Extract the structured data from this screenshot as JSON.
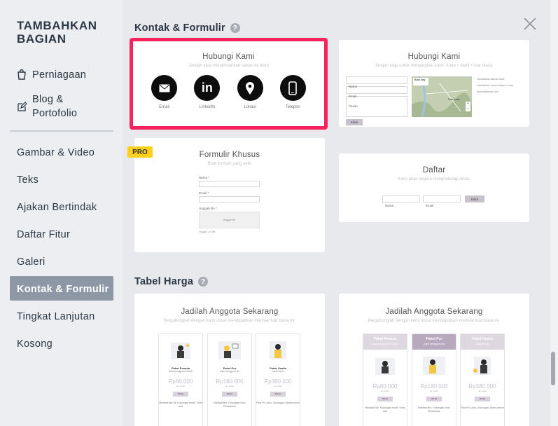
{
  "panel": {
    "title": "TAMBAHKAN BAGIAN"
  },
  "sidebar": {
    "top_items": [
      {
        "label": "Perniagaan",
        "icon": "shopping-bag-icon"
      },
      {
        "label": "Blog & Portofolio",
        "icon": "edit-icon"
      }
    ],
    "items": [
      {
        "label": "Gambar & Video"
      },
      {
        "label": "Teks"
      },
      {
        "label": "Ajakan Bertindak"
      },
      {
        "label": "Daftar Fitur"
      },
      {
        "label": "Galeri"
      },
      {
        "label": "Kontak & Formulir",
        "active": true
      },
      {
        "label": "Tingkat Lanjutan"
      },
      {
        "label": "Kosong"
      }
    ]
  },
  "sections": {
    "contact": {
      "title": "Kontak & Formulir",
      "help": "?"
    },
    "pricing": {
      "title": "Tabel Harga",
      "help": "?"
    }
  },
  "cards": {
    "contact_icons": {
      "title": "Hubungi Kami",
      "subtitle": "Jangan lupa menambahkan tautan ke ikon!",
      "icons": [
        {
          "caption": "Email",
          "icon": "email-icon"
        },
        {
          "caption": "LinkedIn",
          "icon": "linkedin-icon"
        },
        {
          "caption": "Lokasi",
          "icon": "location-pin-icon"
        },
        {
          "caption": "Telepon",
          "icon": "phone-icon"
        }
      ]
    },
    "contact_map": {
      "title": "Hubungi Kami",
      "subtitle": "Jangan ragu untuk menjangkau kami. Anda + kami = luar biasa.",
      "fields": [
        "Nama",
        "Email",
        "Pesan"
      ],
      "button": "Kirim",
      "map_label": "Blast baty",
      "map_city": "San Jose",
      "info": [
        "Tambahkan alamat Anda",
        "Tambahkan nomor telepon Anda",
        "alamat@email.com"
      ]
    },
    "custom_form": {
      "badge": "PRO",
      "title": "Formulir Khusus",
      "subtitle": "Buat formulir yang unik!",
      "fields": [
        "Nama *",
        "Email *",
        "Unggah file *"
      ],
      "upload": "Unggah file",
      "note": "Unggah 10 MB"
    },
    "signup": {
      "title": "Daftar",
      "subtitle": "Kami akan segera menghubungi Anda.",
      "fields": [
        "Nama",
        "Email"
      ],
      "button": "Kirim"
    },
    "pricing_a": {
      "title": "Jadilah Anggota Sekarang",
      "subtitle": "Bergabunglah dengan kami untuk mendapatkan manfaat luar biasa ini.",
      "plans": [
        {
          "name": "Paket Pemula",
          "desc": "untuk pengguna individu",
          "price": "Rp80.000",
          "per": "per bulan",
          "btn": "PILIH",
          "features": "Manfaat fitur ini; Dukungan email; Tidak ada",
          "highlight": false
        },
        {
          "name": "Paket Pro",
          "desc": "untuk pengguna tim",
          "price": "Rp180.000",
          "per": "per bulan",
          "btn": "PILIH",
          "features": "Manfaat fitur; Dukungan chat; Pembaruan",
          "highlight": true
        },
        {
          "name": "Paket Usaha",
          "desc": "untuk bisnis",
          "price": "Rp380.000",
          "per": "per bulan",
          "btn": "PILIH",
          "features": "Fitur Pro, plus; Dukungan; Akses penuh",
          "highlight": false
        }
      ]
    },
    "pricing_b": {
      "title": "Jadilah Anggota Sekarang",
      "subtitle": "Bergabunglah dengan kami untuk mendapatkan manfaat luar biasa ini.",
      "plans": [
        {
          "name": "Paket Pemula",
          "desc": "untuk pengguna individu",
          "price": "Rp80.000",
          "per": "per bulan",
          "btn": "PILIH",
          "features": "Manfaat fitur; Dukungan email; Tidak ada",
          "highlight": false
        },
        {
          "name": "Paket Pro",
          "desc": "untuk pengguna tim",
          "price": "Rp180.000",
          "per": "per bulan",
          "btn": "PILIH",
          "features": "Manfaat fitur; Dukungan chat; Pembaruan",
          "highlight": true
        },
        {
          "name": "Paket Usaha",
          "desc": "untuk bisnis",
          "price": "Rp380.000",
          "per": "per bulan",
          "btn": "PILIH",
          "features": "Fitur Pro, plus; Dukungan; Akses penuh",
          "highlight": false
        }
      ]
    }
  },
  "colors": {
    "selected_border": "#f5245e",
    "active_nav": "#8e97a6",
    "pro_badge": "#ffd11a",
    "background": "#e8e9ed"
  },
  "close": {
    "icon": "close-icon"
  }
}
